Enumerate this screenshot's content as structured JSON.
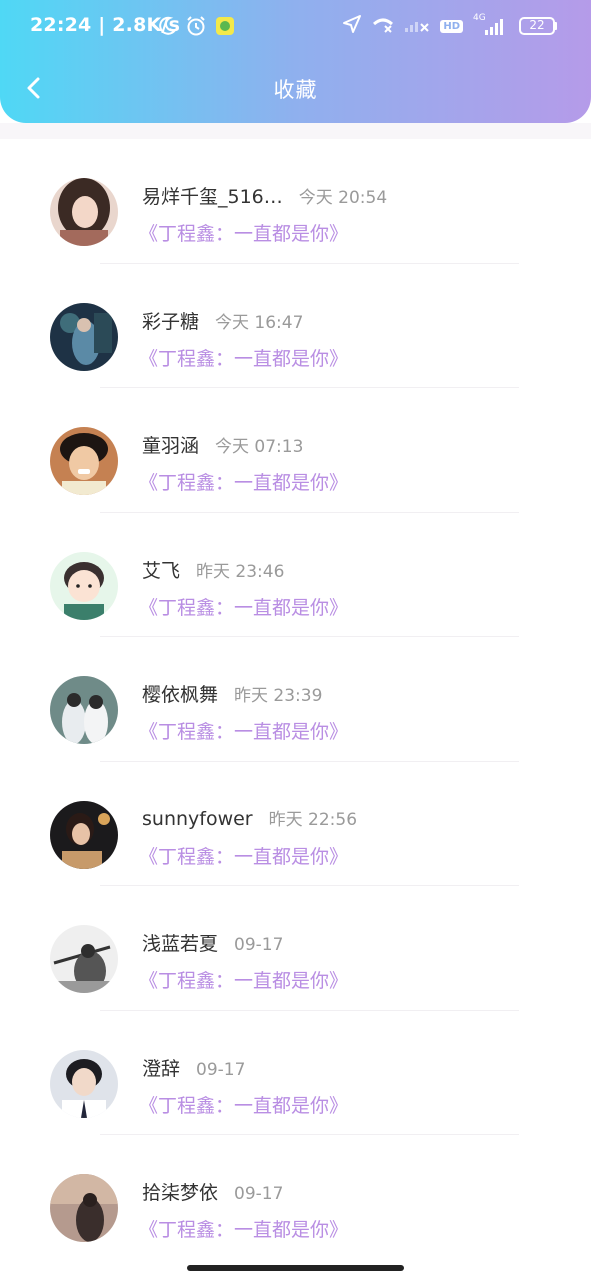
{
  "status_bar": {
    "time_speed": "22:24 | 2.8K/s",
    "network_label": "4G",
    "hd_label": "HD",
    "battery": "22"
  },
  "header": {
    "title": "收藏"
  },
  "items": [
    {
      "name": "易烊千玺_516…",
      "time": "今天 20:54",
      "subtitle": "《丁程鑫：一直都是你》"
    },
    {
      "name": "彩子糖",
      "time": "今天 16:47",
      "subtitle": "《丁程鑫：一直都是你》"
    },
    {
      "name": "童羽涵",
      "time": "今天 07:13",
      "subtitle": "《丁程鑫：一直都是你》"
    },
    {
      "name": "艾飞",
      "time": "昨天 23:46",
      "subtitle": "《丁程鑫：一直都是你》"
    },
    {
      "name": "樱依枫舞",
      "time": "昨天 23:39",
      "subtitle": "《丁程鑫：一直都是你》"
    },
    {
      "name": "sunnyfower",
      "time": "昨天 22:56",
      "subtitle": "《丁程鑫：一直都是你》"
    },
    {
      "name": "浅蓝若夏",
      "time": "09-17",
      "subtitle": "《丁程鑫：一直都是你》"
    },
    {
      "name": "澄辞",
      "time": "09-17",
      "subtitle": "《丁程鑫：一直都是你》"
    },
    {
      "name": "拾柒梦依",
      "time": "09-17",
      "subtitle": "《丁程鑫：一直都是你》"
    }
  ],
  "colors": {
    "accent": "#b98ee3",
    "header_start": "#4fd8f5",
    "header_end": "#b59be9"
  }
}
